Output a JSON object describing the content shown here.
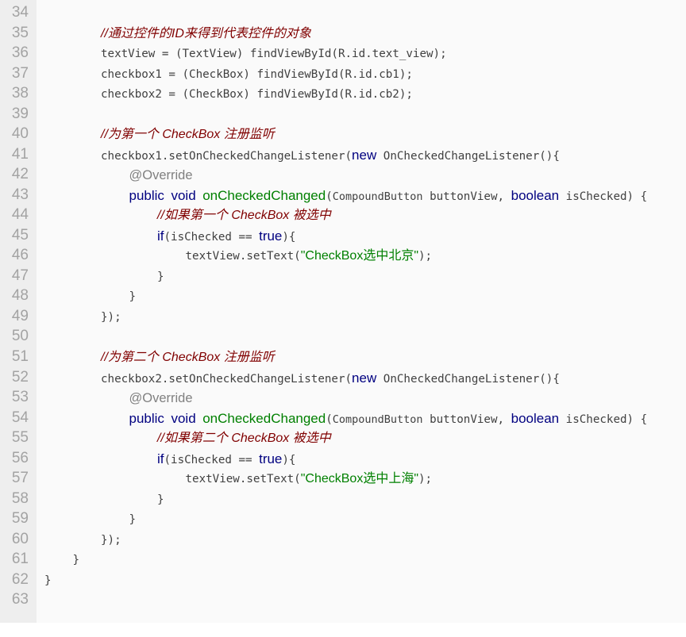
{
  "colors": {
    "gutter_bg": "#eeeeee",
    "code_bg": "#fafafa",
    "line_number": "#a3a3a3",
    "plain": "#404040",
    "comment": "#800000",
    "keyword": "#000080",
    "annotation": "#808080",
    "method": "#008000",
    "string": "#008000"
  },
  "code": {
    "lines": [
      {
        "num": "34",
        "indent": 0,
        "tokens": []
      },
      {
        "num": "35",
        "indent": 2,
        "tokens": [
          {
            "t": "//通过控件的ID来得到代表控件的对象",
            "c": "comment"
          }
        ]
      },
      {
        "num": "36",
        "indent": 2,
        "tokens": [
          {
            "t": "textView = (TextView) findViewById(R.id.text_view);",
            "c": "plain"
          }
        ]
      },
      {
        "num": "37",
        "indent": 2,
        "tokens": [
          {
            "t": "checkbox1 = (CheckBox) findViewById(R.id.cb1);",
            "c": "plain"
          }
        ]
      },
      {
        "num": "38",
        "indent": 2,
        "tokens": [
          {
            "t": "checkbox2 = (CheckBox) findViewById(R.id.cb2);",
            "c": "plain"
          }
        ]
      },
      {
        "num": "39",
        "indent": 0,
        "tokens": []
      },
      {
        "num": "40",
        "indent": 2,
        "tokens": [
          {
            "t": "//为第一个 CheckBox 注册监听",
            "c": "comment"
          }
        ]
      },
      {
        "num": "41",
        "indent": 2,
        "tokens": [
          {
            "t": "checkbox1.setOnCheckedChangeListener(",
            "c": "plain"
          },
          {
            "t": "new",
            "c": "kw"
          },
          {
            "t": " OnCheckedChangeListener(){",
            "c": "plain"
          }
        ]
      },
      {
        "num": "42",
        "indent": 3,
        "tokens": [
          {
            "t": "@Override",
            "c": "anno"
          }
        ]
      },
      {
        "num": "43",
        "indent": 3,
        "tokens": [
          {
            "t": "public",
            "c": "kw"
          },
          {
            "t": " ",
            "c": "plain"
          },
          {
            "t": "void",
            "c": "kw"
          },
          {
            "t": " ",
            "c": "plain"
          },
          {
            "t": "onCheckedChanged",
            "c": "method"
          },
          {
            "t": "(",
            "c": "plain"
          },
          {
            "t": "CompoundButton",
            "c": "type"
          },
          {
            "t": " buttonView, ",
            "c": "plain"
          },
          {
            "t": "boolean",
            "c": "kw"
          },
          {
            "t": " isChecked) {",
            "c": "plain"
          }
        ]
      },
      {
        "num": "44",
        "indent": 4,
        "tokens": [
          {
            "t": "//如果第一个 CheckBox 被选中",
            "c": "comment"
          }
        ]
      },
      {
        "num": "45",
        "indent": 4,
        "tokens": [
          {
            "t": "if",
            "c": "kw"
          },
          {
            "t": "(isChecked == ",
            "c": "plain"
          },
          {
            "t": "true",
            "c": "kw"
          },
          {
            "t": "){",
            "c": "plain"
          }
        ]
      },
      {
        "num": "46",
        "indent": 5,
        "tokens": [
          {
            "t": "textView.setText(",
            "c": "plain"
          },
          {
            "t": "\"CheckBox选中北京\"",
            "c": "str"
          },
          {
            "t": ");",
            "c": "plain"
          }
        ]
      },
      {
        "num": "47",
        "indent": 4,
        "tokens": [
          {
            "t": "}",
            "c": "plain"
          }
        ]
      },
      {
        "num": "48",
        "indent": 3,
        "tokens": [
          {
            "t": "}",
            "c": "plain"
          }
        ]
      },
      {
        "num": "49",
        "indent": 2,
        "tokens": [
          {
            "t": "});",
            "c": "plain"
          }
        ]
      },
      {
        "num": "50",
        "indent": 0,
        "tokens": []
      },
      {
        "num": "51",
        "indent": 2,
        "tokens": [
          {
            "t": "//为第二个 CheckBox 注册监听",
            "c": "comment"
          }
        ]
      },
      {
        "num": "52",
        "indent": 2,
        "tokens": [
          {
            "t": "checkbox2.setOnCheckedChangeListener(",
            "c": "plain"
          },
          {
            "t": "new",
            "c": "kw"
          },
          {
            "t": " OnCheckedChangeListener(){",
            "c": "plain"
          }
        ]
      },
      {
        "num": "53",
        "indent": 3,
        "tokens": [
          {
            "t": "@Override",
            "c": "anno"
          }
        ]
      },
      {
        "num": "54",
        "indent": 3,
        "tokens": [
          {
            "t": "public",
            "c": "kw"
          },
          {
            "t": " ",
            "c": "plain"
          },
          {
            "t": "void",
            "c": "kw"
          },
          {
            "t": " ",
            "c": "plain"
          },
          {
            "t": "onCheckedChanged",
            "c": "method"
          },
          {
            "t": "(",
            "c": "plain"
          },
          {
            "t": "CompoundButton",
            "c": "type"
          },
          {
            "t": " buttonView, ",
            "c": "plain"
          },
          {
            "t": "boolean",
            "c": "kw"
          },
          {
            "t": " isChecked) {",
            "c": "plain"
          }
        ]
      },
      {
        "num": "55",
        "indent": 4,
        "tokens": [
          {
            "t": "//如果第二个 CheckBox 被选中",
            "c": "comment"
          }
        ]
      },
      {
        "num": "56",
        "indent": 4,
        "tokens": [
          {
            "t": "if",
            "c": "kw"
          },
          {
            "t": "(isChecked == ",
            "c": "plain"
          },
          {
            "t": "true",
            "c": "kw"
          },
          {
            "t": "){",
            "c": "plain"
          }
        ]
      },
      {
        "num": "57",
        "indent": 5,
        "tokens": [
          {
            "t": "textView.setText(",
            "c": "plain"
          },
          {
            "t": "\"CheckBox选中上海\"",
            "c": "str"
          },
          {
            "t": ");",
            "c": "plain"
          }
        ]
      },
      {
        "num": "58",
        "indent": 4,
        "tokens": [
          {
            "t": "}",
            "c": "plain"
          }
        ]
      },
      {
        "num": "59",
        "indent": 3,
        "tokens": [
          {
            "t": "}",
            "c": "plain"
          }
        ]
      },
      {
        "num": "60",
        "indent": 2,
        "tokens": [
          {
            "t": "});",
            "c": "plain"
          }
        ]
      },
      {
        "num": "61",
        "indent": 1,
        "tokens": [
          {
            "t": "}",
            "c": "plain"
          }
        ]
      },
      {
        "num": "62",
        "indent": 0,
        "tokens": [
          {
            "t": "}",
            "c": "plain"
          }
        ]
      },
      {
        "num": "63",
        "indent": 0,
        "tokens": []
      }
    ]
  }
}
